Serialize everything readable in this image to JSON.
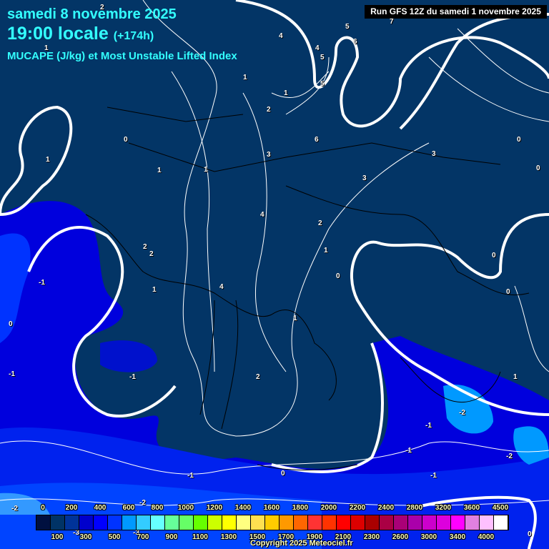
{
  "header": {
    "date": "samedi 8 novembre 2025",
    "time": "19:00 locale",
    "lead": "(+174h)",
    "parameter": "MUCAPE (J/kg) et Most Unstable Lifted Index",
    "run": "Run GFS 12Z du samedi 1 novembre 2025"
  },
  "contour_labels": [
    "2",
    "1",
    "4",
    "5",
    "6",
    "5",
    "4",
    "5",
    "7",
    "1",
    "1",
    "2",
    "0",
    "1",
    "1",
    "3",
    "6",
    "3",
    "0",
    "0",
    "1",
    "3",
    "4",
    "2",
    "2",
    "2",
    "1",
    "1",
    "0",
    "0",
    "0",
    "4",
    "1",
    "-1",
    "0",
    "-1",
    "-1",
    "2",
    "1",
    "-1",
    "-2",
    "-1",
    "-2",
    "-1",
    "0",
    "-1",
    "-2",
    "-2",
    "-3",
    "-3",
    "0"
  ],
  "legend": {
    "top_labels": [
      "0",
      "200",
      "400",
      "600",
      "800",
      "1000",
      "1200",
      "1400",
      "1600",
      "1800",
      "2000",
      "2200",
      "2400",
      "2800",
      "3200",
      "3600",
      "4500"
    ],
    "bottom_labels": [
      "100",
      "300",
      "500",
      "700",
      "900",
      "1100",
      "1300",
      "1500",
      "1700",
      "1900",
      "2100",
      "2300",
      "2600",
      "3000",
      "3400",
      "4000"
    ],
    "colors": [
      "#001040",
      "#003366",
      "#003399",
      "#0000cc",
      "#0000ff",
      "#0033ff",
      "#0099ff",
      "#33ccff",
      "#66ffff",
      "#66ff99",
      "#66ff66",
      "#66ff00",
      "#ccff00",
      "#ffff00",
      "#ffff80",
      "#ffe050",
      "#ffcc00",
      "#ff9900",
      "#ff6600",
      "#ff3333",
      "#ff3300",
      "#ff0000",
      "#dd0000",
      "#aa0000",
      "#aa0044",
      "#aa0077",
      "#aa00aa",
      "#cc00cc",
      "#dd00dd",
      "#ff00ff",
      "#e080e0",
      "#ffc0ff",
      "#ffffff"
    ]
  },
  "copyright": "Copyright 2025 Meteociel.fr"
}
